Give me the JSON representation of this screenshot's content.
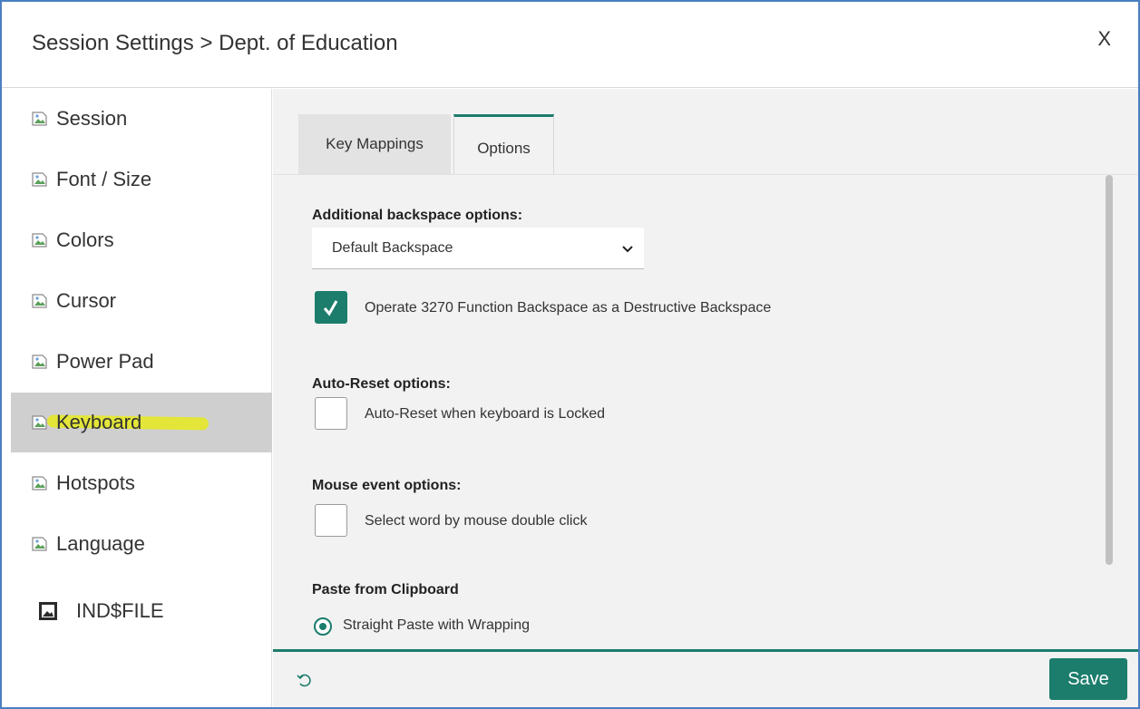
{
  "window": {
    "title": "Session Settings > Dept. of Education",
    "close_label": "X"
  },
  "sidebar": {
    "items": [
      {
        "label": "Session",
        "icon": "broken-image-icon"
      },
      {
        "label": "Font / Size",
        "icon": "broken-image-icon"
      },
      {
        "label": "Colors",
        "icon": "broken-image-icon"
      },
      {
        "label": "Cursor",
        "icon": "broken-image-icon"
      },
      {
        "label": "Power Pad",
        "icon": "broken-image-icon"
      },
      {
        "label": "Keyboard",
        "icon": "broken-image-icon",
        "active": true
      },
      {
        "label": "Hotspots",
        "icon": "broken-image-icon"
      },
      {
        "label": "Language",
        "icon": "broken-image-icon"
      },
      {
        "label": "IND$FILE",
        "icon": "image-icon"
      }
    ]
  },
  "tabs": [
    {
      "label": "Key Mappings",
      "active": false
    },
    {
      "label": "Options",
      "active": true
    }
  ],
  "options": {
    "backspace": {
      "heading": "Additional backspace options:",
      "select_value": "Default Backspace",
      "checkbox_label": "Operate 3270 Function Backspace as a Destructive Backspace",
      "checked": true
    },
    "auto_reset": {
      "heading": "Auto-Reset options:",
      "checkbox_label": "Auto-Reset when keyboard is Locked",
      "checked": false
    },
    "mouse": {
      "heading": "Mouse event options:",
      "checkbox_label": "Select word by mouse double click",
      "checked": false
    },
    "paste": {
      "heading": "Paste from Clipboard",
      "radio_label": "Straight Paste with Wrapping",
      "selected": true
    }
  },
  "footer": {
    "save_label": "Save",
    "reset_icon": "reset-icon"
  },
  "colors": {
    "accent": "#1c7d6c",
    "border": "#4a7fc1",
    "highlight": "#e6ea1f"
  }
}
